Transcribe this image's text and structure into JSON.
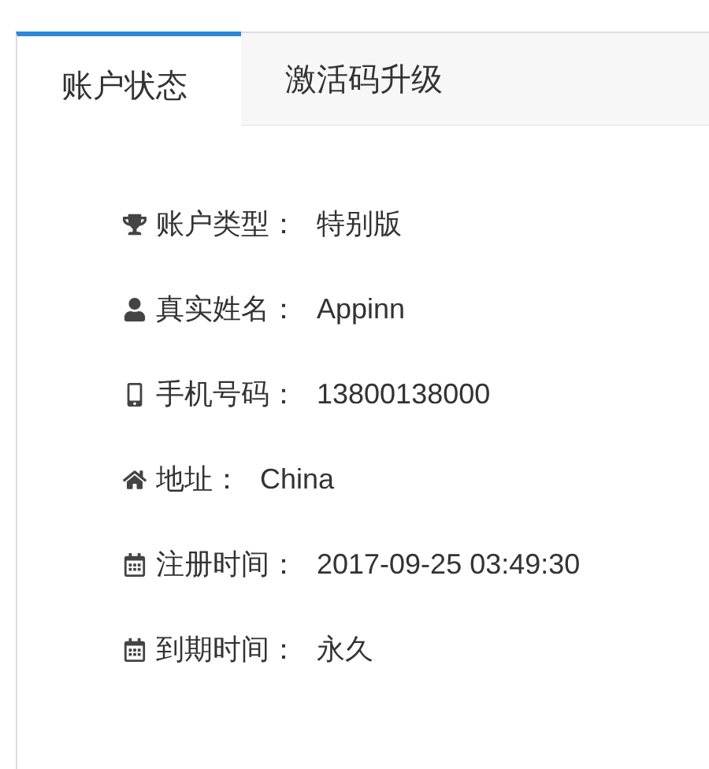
{
  "tabs": [
    {
      "label": "账户状态",
      "selected": true
    },
    {
      "label": "激活码升级",
      "selected": false
    }
  ],
  "fields": [
    {
      "label": "账户类型：",
      "value": "特别版"
    },
    {
      "label": "真实姓名：",
      "value": "Appinn"
    },
    {
      "label": "手机号码：",
      "value": "13800138000"
    },
    {
      "label": "地址：",
      "value": "China"
    },
    {
      "label": "注册时间：",
      "value": "2017-09-25 03:49:30"
    },
    {
      "label": "到期时间：",
      "value": "永久"
    }
  ]
}
